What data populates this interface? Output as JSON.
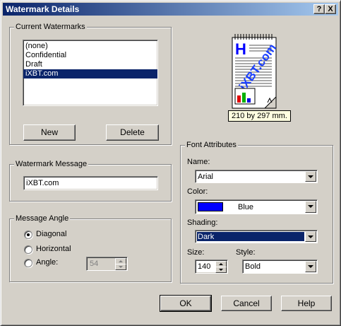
{
  "window": {
    "title": "Watermark Details"
  },
  "caption_buttons": {
    "help": "?",
    "close": "X"
  },
  "current_watermarks": {
    "label": "Current Watermarks",
    "items": [
      "(none)",
      "Confidential",
      "Draft",
      "iXBT.com"
    ],
    "selected_index": 3,
    "new_label": "New",
    "delete_label": "Delete"
  },
  "preview": {
    "heading_letter": "H",
    "watermark_text": "iXBT.com",
    "paper_size": "210 by 297 mm."
  },
  "watermark_message": {
    "label": "Watermark Message",
    "value": "iXBT.com"
  },
  "message_angle": {
    "label": "Message Angle",
    "options": [
      "Diagonal",
      "Horizontal",
      "Angle:"
    ],
    "selected": "Diagonal",
    "angle_value": "54"
  },
  "font_attributes": {
    "label": "Font Attributes",
    "name_label": "Name:",
    "name_value": "Arial",
    "color_label": "Color:",
    "color_value": "Blue",
    "color_swatch": "#0000ff",
    "shading_label": "Shading:",
    "shading_value": "Dark",
    "size_label": "Size:",
    "size_value": "140",
    "style_label": "Style:",
    "style_value": "Bold"
  },
  "buttons": {
    "ok": "OK",
    "cancel": "Cancel",
    "help": "Help"
  },
  "colors": {
    "title_bar_start": "#0a246a",
    "title_bar_end": "#a6caf0",
    "dialog_face": "#d4d0c8",
    "selection": "#0a246a"
  }
}
